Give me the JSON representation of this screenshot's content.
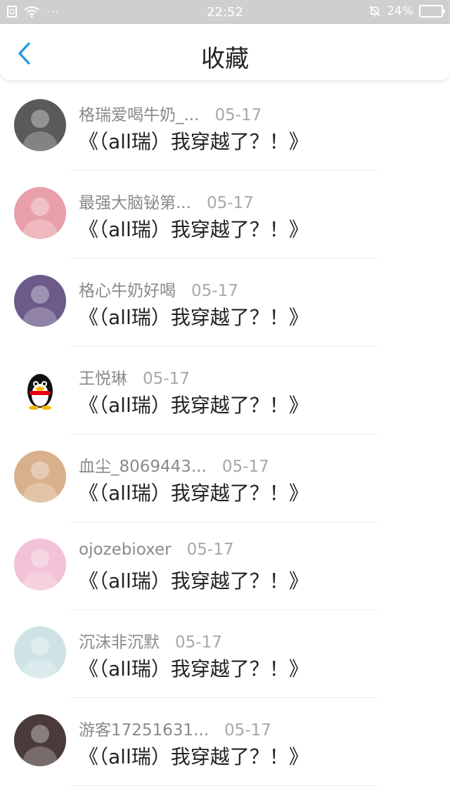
{
  "status_bar": {
    "time": "22:52",
    "battery": "24%",
    "battery_level": 0.24,
    "dots": "···"
  },
  "header": {
    "title": "收藏"
  },
  "items": [
    {
      "name": "格瑞爱喝牛奶_...",
      "date": "05-17",
      "title": "《（all瑞）我穿越了？！》",
      "avatar_color": "#5a5a5a"
    },
    {
      "name": "最强大脑铋第...",
      "date": "05-17",
      "title": "《（all瑞）我穿越了？！》",
      "avatar_color": "#e8a0a8"
    },
    {
      "name": "格心牛奶好喝",
      "date": "05-17",
      "title": "《（all瑞）我穿越了？！》",
      "avatar_color": "#6b5a8a"
    },
    {
      "name": "王悦琳",
      "date": "05-17",
      "title": "《（all瑞）我穿越了？！》",
      "avatar_color": "#ffffff"
    },
    {
      "name": "血尘_8069443...",
      "date": "05-17",
      "title": "《（all瑞）我穿越了？！》",
      "avatar_color": "#d9b08c"
    },
    {
      "name": "ojozebioxer",
      "date": "05-17",
      "title": "《（all瑞）我穿越了？！》",
      "avatar_color": "#f2c2d6"
    },
    {
      "name": "沉沫非沉默",
      "date": "05-17",
      "title": "《（all瑞）我穿越了？！》",
      "avatar_color": "#cfe3e6"
    },
    {
      "name": "游客17251631...",
      "date": "05-17",
      "title": "《（all瑞）我穿越了？！》",
      "avatar_color": "#4a3a3a"
    }
  ],
  "colors": {
    "accent": "#1a9be6",
    "status_bar_bg": "#cfcfcf"
  }
}
